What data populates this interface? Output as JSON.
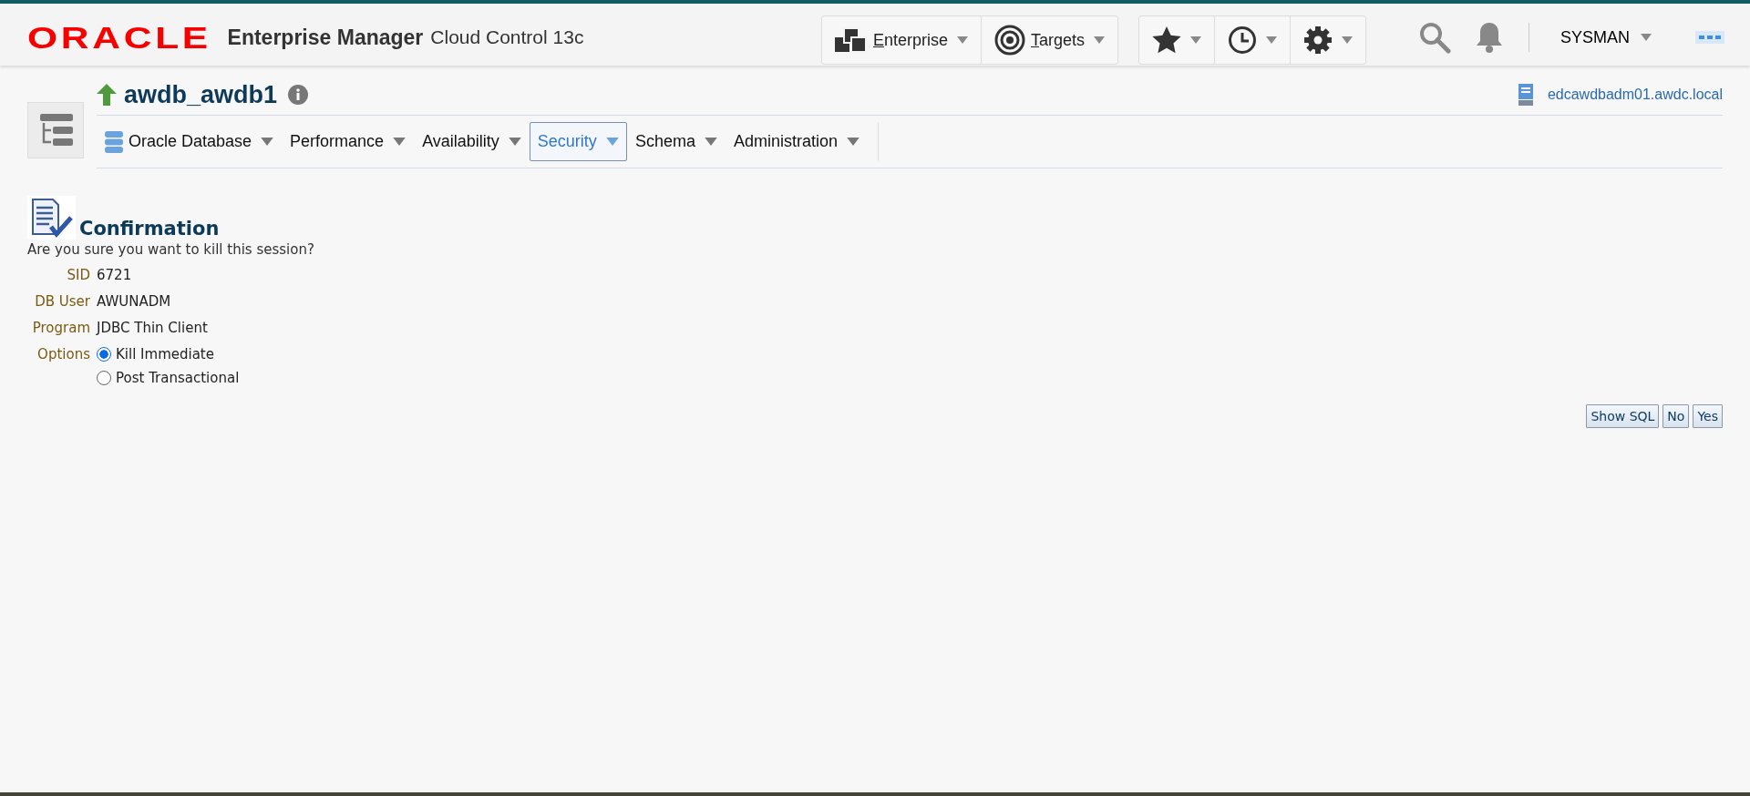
{
  "header": {
    "logo": "ORACLE",
    "product": "Enterprise Manager",
    "subtitle": "Cloud Control 13c",
    "menus": [
      {
        "kind": "enterprise",
        "label": "Enterprise"
      },
      {
        "kind": "targets",
        "label": "Targets"
      }
    ],
    "tools": [
      {
        "kind": "star"
      },
      {
        "kind": "clock"
      },
      {
        "kind": "gear"
      }
    ],
    "user": "SYSMAN"
  },
  "target": {
    "name": "awdb_awdb1",
    "host": "edcawdbadm01.awdc.local"
  },
  "nav": [
    {
      "label": "Oracle Database",
      "selected": false,
      "icon": true
    },
    {
      "label": "Performance",
      "selected": false
    },
    {
      "label": "Availability",
      "selected": false
    },
    {
      "label": "Security",
      "selected": true
    },
    {
      "label": "Schema",
      "selected": false
    },
    {
      "label": "Administration",
      "selected": false
    }
  ],
  "confirmation": {
    "title": "Confirmation",
    "message": "Are you sure you want to kill this session?",
    "fields": [
      {
        "label": "SID",
        "value": "6721"
      },
      {
        "label": "DB User",
        "value": "AWUNADM"
      },
      {
        "label": "Program",
        "value": "JDBC Thin Client"
      }
    ],
    "options_label": "Options",
    "options": [
      {
        "label": "Kill Immediate",
        "selected": true
      },
      {
        "label": "Post Transactional",
        "selected": false
      }
    ]
  },
  "buttons": [
    "Show SQL",
    "No",
    "Yes"
  ]
}
